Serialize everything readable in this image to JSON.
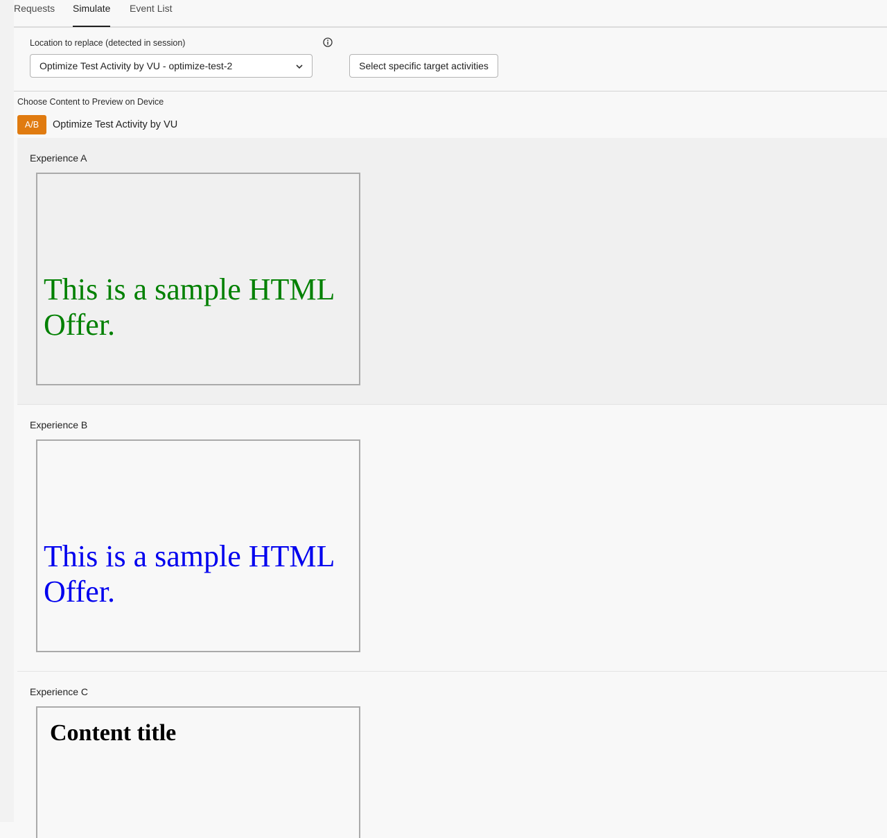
{
  "tabs": [
    {
      "label": "Requests"
    },
    {
      "label": "Simulate"
    },
    {
      "label": "Event List"
    }
  ],
  "location": {
    "label": "Location to replace (detected in session)",
    "selected": "Optimize Test Activity by VU - optimize-test-2"
  },
  "target_button": {
    "label": "Select specific target activities"
  },
  "content": {
    "label": "Choose Content to Preview on Device",
    "badge": "A/B",
    "activity_name": "Optimize Test Activity by VU"
  },
  "experiences": [
    {
      "title": "Experience A",
      "offer_text": "This is a sample HTML Offer.",
      "offer_color": "#008000"
    },
    {
      "title": "Experience B",
      "offer_text": "This is a sample HTML Offer.",
      "offer_color": "#0000ee"
    },
    {
      "title": "Experience C",
      "content_title": "Content title"
    }
  ],
  "colors": {
    "badge": "#e07b10",
    "selected_section": "#f0f0f0"
  },
  "icons": [
    "info-icon",
    "chevron-down-icon"
  ]
}
